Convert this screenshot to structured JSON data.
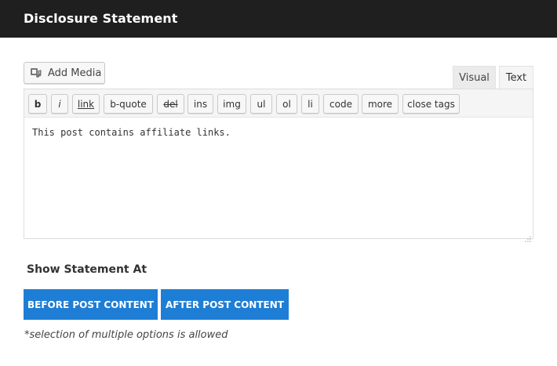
{
  "header": {
    "title": "Disclosure Statement"
  },
  "editor": {
    "add_media_label": "Add Media",
    "tabs": [
      {
        "label": "Visual"
      },
      {
        "label": "Text"
      }
    ],
    "active_tab": "Text",
    "toolbar": [
      {
        "label": "b"
      },
      {
        "label": "i"
      },
      {
        "label": "link"
      },
      {
        "label": "b-quote"
      },
      {
        "label": "del"
      },
      {
        "label": "ins"
      },
      {
        "label": "img"
      },
      {
        "label": "ul"
      },
      {
        "label": "ol"
      },
      {
        "label": "li"
      },
      {
        "label": "code"
      },
      {
        "label": "more"
      },
      {
        "label": "close tags"
      }
    ],
    "content": "This post contains affiliate links."
  },
  "show_statement": {
    "label": "Show Statement At",
    "options": [
      {
        "label": "BEFORE POST CONTENT"
      },
      {
        "label": "AFTER POST CONTENT"
      }
    ],
    "note": "*selection of multiple options is allowed"
  },
  "colors": {
    "header_bg": "#1f1f1f",
    "option_button_bg": "#1e7ed5"
  },
  "icons": {
    "add_media": "media-icon",
    "resize": "resize-handle-icon"
  }
}
